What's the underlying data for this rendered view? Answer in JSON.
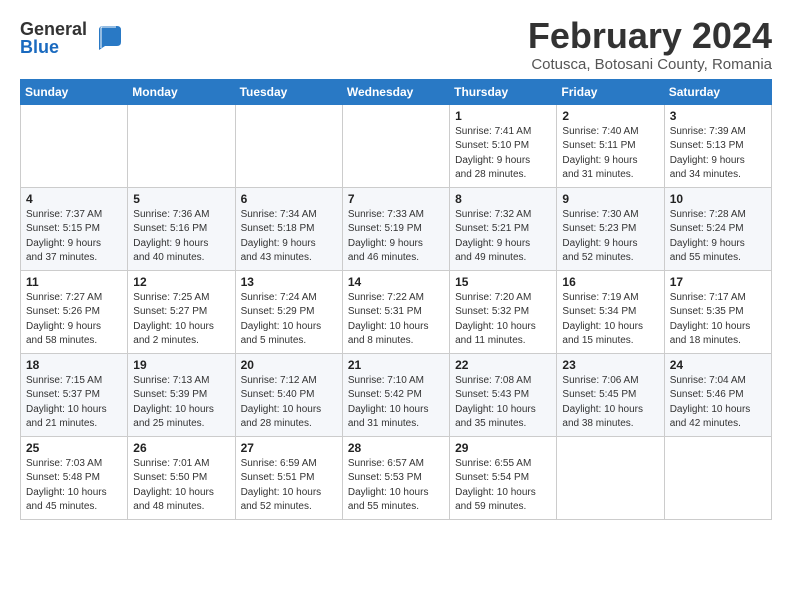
{
  "logo": {
    "general": "General",
    "blue": "Blue"
  },
  "title": "February 2024",
  "subtitle": "Cotusca, Botosani County, Romania",
  "weekdays": [
    "Sunday",
    "Monday",
    "Tuesday",
    "Wednesday",
    "Thursday",
    "Friday",
    "Saturday"
  ],
  "weeks": [
    [
      {
        "day": "",
        "info": ""
      },
      {
        "day": "",
        "info": ""
      },
      {
        "day": "",
        "info": ""
      },
      {
        "day": "",
        "info": ""
      },
      {
        "day": "1",
        "info": "Sunrise: 7:41 AM\nSunset: 5:10 PM\nDaylight: 9 hours\nand 28 minutes."
      },
      {
        "day": "2",
        "info": "Sunrise: 7:40 AM\nSunset: 5:11 PM\nDaylight: 9 hours\nand 31 minutes."
      },
      {
        "day": "3",
        "info": "Sunrise: 7:39 AM\nSunset: 5:13 PM\nDaylight: 9 hours\nand 34 minutes."
      }
    ],
    [
      {
        "day": "4",
        "info": "Sunrise: 7:37 AM\nSunset: 5:15 PM\nDaylight: 9 hours\nand 37 minutes."
      },
      {
        "day": "5",
        "info": "Sunrise: 7:36 AM\nSunset: 5:16 PM\nDaylight: 9 hours\nand 40 minutes."
      },
      {
        "day": "6",
        "info": "Sunrise: 7:34 AM\nSunset: 5:18 PM\nDaylight: 9 hours\nand 43 minutes."
      },
      {
        "day": "7",
        "info": "Sunrise: 7:33 AM\nSunset: 5:19 PM\nDaylight: 9 hours\nand 46 minutes."
      },
      {
        "day": "8",
        "info": "Sunrise: 7:32 AM\nSunset: 5:21 PM\nDaylight: 9 hours\nand 49 minutes."
      },
      {
        "day": "9",
        "info": "Sunrise: 7:30 AM\nSunset: 5:23 PM\nDaylight: 9 hours\nand 52 minutes."
      },
      {
        "day": "10",
        "info": "Sunrise: 7:28 AM\nSunset: 5:24 PM\nDaylight: 9 hours\nand 55 minutes."
      }
    ],
    [
      {
        "day": "11",
        "info": "Sunrise: 7:27 AM\nSunset: 5:26 PM\nDaylight: 9 hours\nand 58 minutes."
      },
      {
        "day": "12",
        "info": "Sunrise: 7:25 AM\nSunset: 5:27 PM\nDaylight: 10 hours\nand 2 minutes."
      },
      {
        "day": "13",
        "info": "Sunrise: 7:24 AM\nSunset: 5:29 PM\nDaylight: 10 hours\nand 5 minutes."
      },
      {
        "day": "14",
        "info": "Sunrise: 7:22 AM\nSunset: 5:31 PM\nDaylight: 10 hours\nand 8 minutes."
      },
      {
        "day": "15",
        "info": "Sunrise: 7:20 AM\nSunset: 5:32 PM\nDaylight: 10 hours\nand 11 minutes."
      },
      {
        "day": "16",
        "info": "Sunrise: 7:19 AM\nSunset: 5:34 PM\nDaylight: 10 hours\nand 15 minutes."
      },
      {
        "day": "17",
        "info": "Sunrise: 7:17 AM\nSunset: 5:35 PM\nDaylight: 10 hours\nand 18 minutes."
      }
    ],
    [
      {
        "day": "18",
        "info": "Sunrise: 7:15 AM\nSunset: 5:37 PM\nDaylight: 10 hours\nand 21 minutes."
      },
      {
        "day": "19",
        "info": "Sunrise: 7:13 AM\nSunset: 5:39 PM\nDaylight: 10 hours\nand 25 minutes."
      },
      {
        "day": "20",
        "info": "Sunrise: 7:12 AM\nSunset: 5:40 PM\nDaylight: 10 hours\nand 28 minutes."
      },
      {
        "day": "21",
        "info": "Sunrise: 7:10 AM\nSunset: 5:42 PM\nDaylight: 10 hours\nand 31 minutes."
      },
      {
        "day": "22",
        "info": "Sunrise: 7:08 AM\nSunset: 5:43 PM\nDaylight: 10 hours\nand 35 minutes."
      },
      {
        "day": "23",
        "info": "Sunrise: 7:06 AM\nSunset: 5:45 PM\nDaylight: 10 hours\nand 38 minutes."
      },
      {
        "day": "24",
        "info": "Sunrise: 7:04 AM\nSunset: 5:46 PM\nDaylight: 10 hours\nand 42 minutes."
      }
    ],
    [
      {
        "day": "25",
        "info": "Sunrise: 7:03 AM\nSunset: 5:48 PM\nDaylight: 10 hours\nand 45 minutes."
      },
      {
        "day": "26",
        "info": "Sunrise: 7:01 AM\nSunset: 5:50 PM\nDaylight: 10 hours\nand 48 minutes."
      },
      {
        "day": "27",
        "info": "Sunrise: 6:59 AM\nSunset: 5:51 PM\nDaylight: 10 hours\nand 52 minutes."
      },
      {
        "day": "28",
        "info": "Sunrise: 6:57 AM\nSunset: 5:53 PM\nDaylight: 10 hours\nand 55 minutes."
      },
      {
        "day": "29",
        "info": "Sunrise: 6:55 AM\nSunset: 5:54 PM\nDaylight: 10 hours\nand 59 minutes."
      },
      {
        "day": "",
        "info": ""
      },
      {
        "day": "",
        "info": ""
      }
    ]
  ]
}
